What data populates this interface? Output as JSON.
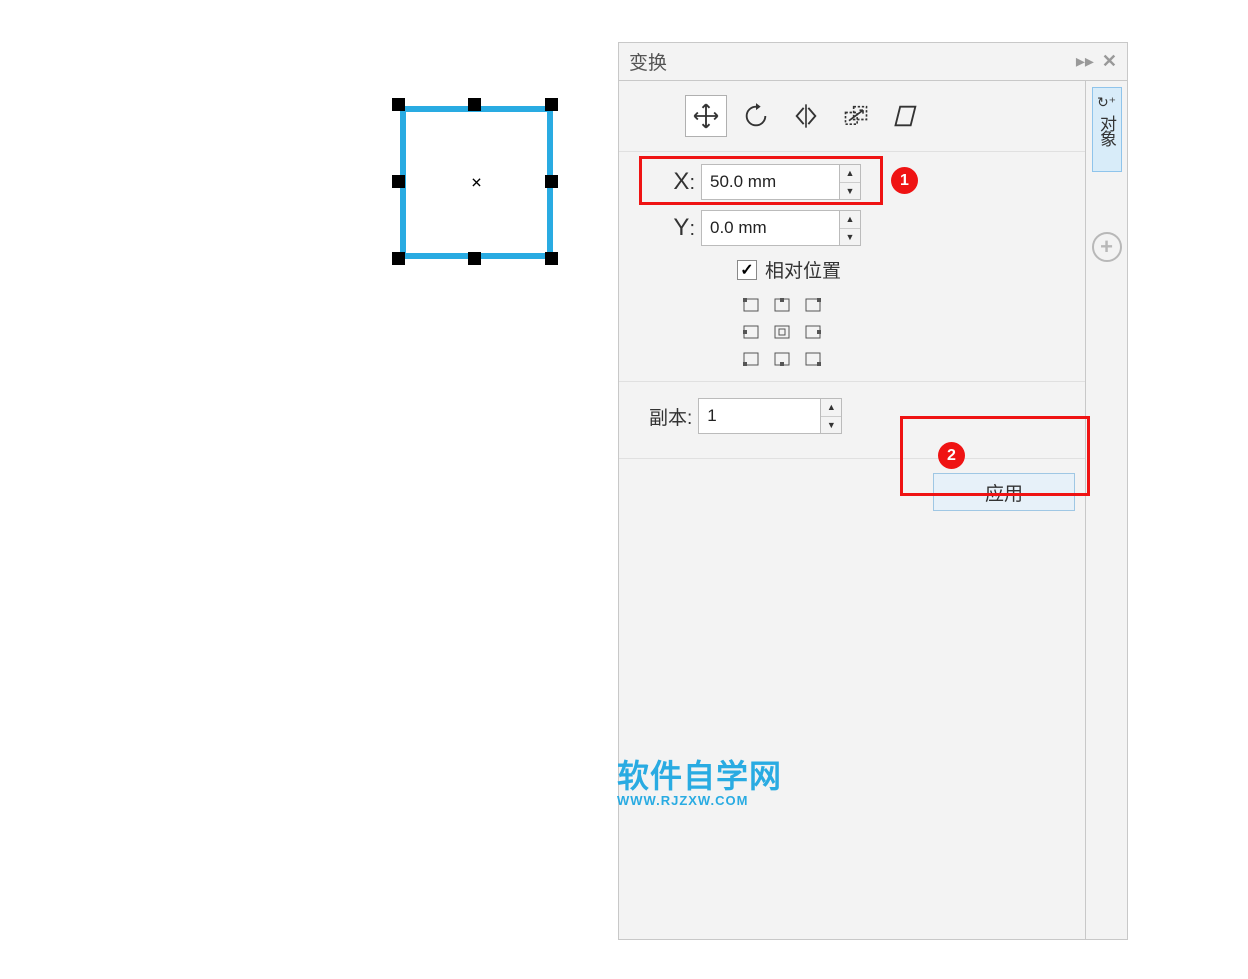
{
  "panel": {
    "title": "变换",
    "x_label": "X",
    "y_label": "Y",
    "x_value": "50.0 mm",
    "y_value": "0.0 mm",
    "relative_label": "相对位置",
    "relative_checked": "✓",
    "copies_label": "副本:",
    "copies_value": "1",
    "apply_label": "应用",
    "side_tab_label": "对象"
  },
  "callout": {
    "num1": "1",
    "num2": "2"
  },
  "watermark": {
    "line1": "软件自学网",
    "line2": "WWW.RJZXW.COM"
  }
}
